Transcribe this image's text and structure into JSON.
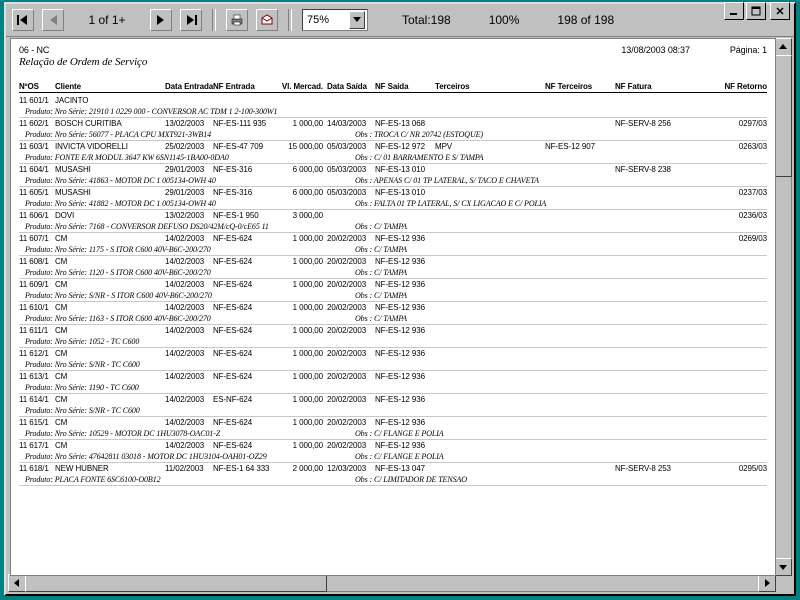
{
  "window_controls": {
    "min": "_",
    "max": "❐",
    "close": "✕"
  },
  "toolbar": {
    "page_indicator": "1 of 1+",
    "zoom": "75%",
    "total": "Total:198",
    "pct": "100%",
    "records": "198 of 198"
  },
  "report": {
    "code": "06 - NC",
    "date": "13/08/2003  08:37",
    "page": "Página: 1",
    "subtitle": "Relação de Ordem de Serviço",
    "headers": {
      "nos": "NºOS",
      "cliente": "Cliente",
      "dte": "Data Entrada",
      "nfe": "NF Entrada",
      "vl": "Vl. Mercad.",
      "dts": "Data Saída",
      "nfs": "NF Saída",
      "ter": "Terceiros",
      "nft": "NF Terceiros",
      "nff": "NF Fatura",
      "ret": "NF Retorno"
    }
  },
  "rows": [
    {
      "no": "11 601/1",
      "cli": "JACINTO",
      "dte": "",
      "nfe": "",
      "vl": "",
      "dts": "",
      "nfs": "",
      "ter": "",
      "nft": "",
      "nff": "",
      "ret": "",
      "prod": "Produto: Nro Série: 21910 1 0229 000 - CONVERSOR AC TDM  1 2-100-300W1",
      "obs": ""
    },
    {
      "no": "11 602/1",
      "cli": "BOSCH CURITIBA",
      "dte": "13/02/2003",
      "nfe": "NF-ES-111 935",
      "vl": "1 000,00",
      "dts": "14/03/2003",
      "nfs": "NF-ES-13 068",
      "ter": "",
      "nft": "",
      "nff": "NF-SERV-8 256",
      "ret": "0297/03",
      "prod": "Produto: Nro Série: 56077 - PLACA CPU MXT921-3WB14",
      "obs": "Obs : TROCA C/ NR 20742 (ESTOQUE)"
    },
    {
      "no": "11 603/1",
      "cli": "INVICTA VIDORELLI",
      "dte": "25/02/2003",
      "nfe": "NF-ES-47 709",
      "vl": "15 000,00",
      "dts": "05/03/2003",
      "nfs": "NF-ES-12 972",
      "ter": "MPV",
      "nft": "NF-ES-12 907",
      "nff": "",
      "ret": "0263/03",
      "prod": "Produto: FONTE E/R MODUL 3647 KW 6SN1145-1BA00-0DA0",
      "obs": "Obs : C/ 01 BARRAMENTO E S/ TAMPA"
    },
    {
      "no": "11 604/1",
      "cli": "MUSASHI",
      "dte": "29/01/2003",
      "nfe": "NF-ES-316",
      "vl": "6 000,00",
      "dts": "05/03/2003",
      "nfs": "NF-ES-13 010",
      "ter": "",
      "nft": "",
      "nff": "NF-SERV-8 238",
      "ret": "",
      "prod": "Produto: Nro Série: 41863 - MOTOR DC 1 005134-OWH 40",
      "obs": "Obs : APENAS C/ 01 TP LATERAL, S/ TACO E CHAVETA"
    },
    {
      "no": "11 605/1",
      "cli": "MUSASHI",
      "dte": "29/01/2003",
      "nfe": "NF-ES-316",
      "vl": "6 000,00",
      "dts": "05/03/2003",
      "nfs": "NF-ES-13 010",
      "ter": "",
      "nft": "",
      "nff": "",
      "ret": "0237/03",
      "prod": "Produto: Nro Série: 41882 - MOTOR DC 1 005134-OWH 40",
      "obs": "Obs : FALTA 01 TP LATERAL, S/ CX LIGACAO E C/ POLIA"
    },
    {
      "no": "11 606/1",
      "cli": "DOVI",
      "dte": "13/02/2003",
      "nfe": "NF-ES-1 950",
      "vl": "3 000,00",
      "dts": "",
      "nfs": "",
      "ter": "",
      "nft": "",
      "nff": "",
      "ret": "0236/03",
      "prod": "Produto: Nro Série: 7168 - CONVERSOR DEFUSO DS20/42M/cQ-0/cE65 11",
      "obs": "Obs : C/ TAMPA"
    },
    {
      "no": "11 607/1",
      "cli": "CM",
      "dte": "14/02/2003",
      "nfe": "NF-ES-624",
      "vl": "1 000,00",
      "dts": "20/02/2003",
      "nfs": "NF-ES-12 936",
      "ter": "",
      "nft": "",
      "nff": "",
      "ret": "0269/03",
      "prod": "Produto: Nro Série: 1175 - S ITOR C600 40V-B6C-200/270",
      "obs": "Obs : C/ TAMPA"
    },
    {
      "no": "11 608/1",
      "cli": "CM",
      "dte": "14/02/2003",
      "nfe": "NF-ES-624",
      "vl": "1 000,00",
      "dts": "20/02/2003",
      "nfs": "NF-ES-12 936",
      "ter": "",
      "nft": "",
      "nff": "",
      "ret": "",
      "prod": "Produto: Nro Série: 1120 - S ITOR C600 40V-B6C-200/270",
      "obs": "Obs : C/ TAMPA"
    },
    {
      "no": "11 609/1",
      "cli": "CM",
      "dte": "14/02/2003",
      "nfe": "NF-ES-624",
      "vl": "1 000,00",
      "dts": "20/02/2003",
      "nfs": "NF-ES-12 936",
      "ter": "",
      "nft": "",
      "nff": "",
      "ret": "",
      "prod": "Produto: Nro Série: S/NR - S ITOR C600 40V-B6C-200/270",
      "obs": "Obs : C/ TAMPA"
    },
    {
      "no": "11 610/1",
      "cli": "CM",
      "dte": "14/02/2003",
      "nfe": "NF-ES-624",
      "vl": "1 000,00",
      "dts": "20/02/2003",
      "nfs": "NF-ES-12 936",
      "ter": "",
      "nft": "",
      "nff": "",
      "ret": "",
      "prod": "Produto: Nro Série: 1163 - S ITOR C600 40V-B6C-200/270",
      "obs": "Obs : C/ TAMPA"
    },
    {
      "no": "11 611/1",
      "cli": "CM",
      "dte": "14/02/2003",
      "nfe": "NF-ES-624",
      "vl": "1 000,00",
      "dts": "20/02/2003",
      "nfs": "NF-ES-12 936",
      "ter": "",
      "nft": "",
      "nff": "",
      "ret": "",
      "prod": "Produto: Nro Série: 1052 - TC C600",
      "obs": ""
    },
    {
      "no": "11 612/1",
      "cli": "CM",
      "dte": "14/02/2003",
      "nfe": "NF-ES-624",
      "vl": "1 000,00",
      "dts": "20/02/2003",
      "nfs": "NF-ES-12 936",
      "ter": "",
      "nft": "",
      "nff": "",
      "ret": "",
      "prod": "Produto: Nro Série: S/NR - TC C600",
      "obs": ""
    },
    {
      "no": "11 613/1",
      "cli": "CM",
      "dte": "14/02/2003",
      "nfe": "NF-ES-624",
      "vl": "1 000,00",
      "dts": "20/02/2003",
      "nfs": "NF-ES-12 936",
      "ter": "",
      "nft": "",
      "nff": "",
      "ret": "",
      "prod": "Produto: Nro Série: 1190 - TC C600",
      "obs": ""
    },
    {
      "no": "11 614/1",
      "cli": "CM",
      "dte": "14/02/2003",
      "nfe": "ES-NF-624",
      "vl": "1 000,00",
      "dts": "20/02/2003",
      "nfs": "NF-ES-12 936",
      "ter": "",
      "nft": "",
      "nff": "",
      "ret": "",
      "prod": "Produto: Nro Série: S/NR - TC C600",
      "obs": ""
    },
    {
      "no": "11 615/1",
      "cli": "CM",
      "dte": "14/02/2003",
      "nfe": "NF-ES-624",
      "vl": "1 000,00",
      "dts": "20/02/2003",
      "nfs": "NF-ES-12 936",
      "ter": "",
      "nft": "",
      "nff": "",
      "ret": "",
      "prod": "Produto: Nro Série: 10529 - MOTOR DC 1HU3078-OAC01-Z",
      "obs": "Obs : C/ FLANGE E POLIA"
    },
    {
      "no": "11 617/1",
      "cli": "CM",
      "dte": "14/02/2003",
      "nfe": "NF-ES-624",
      "vl": "1 000,00",
      "dts": "20/02/2003",
      "nfs": "NF-ES-12 936",
      "ter": "",
      "nft": "",
      "nff": "",
      "ret": "",
      "prod": "Produto: Nro Série: 47642811 03018 - MOTOR DC 1HU3104-OAH01-OZ29",
      "obs": "Obs : C/ FLANGE E POLIA"
    },
    {
      "no": "11 618/1",
      "cli": "NEW HUBNER",
      "dte": "11/02/2003",
      "nfe": "NF-ES-1 64 333",
      "vl": "2 000,00",
      "dts": "12/03/2003",
      "nfs": "NF-ES-13 047",
      "ter": "",
      "nft": "",
      "nff": "NF-SERV-8 253",
      "ret": "0295/03",
      "prod": "Produto: PLACA FONTE 6SC6100-O0B12",
      "obs": "Obs : C/ LIMITADOR DE TENSAO"
    }
  ]
}
